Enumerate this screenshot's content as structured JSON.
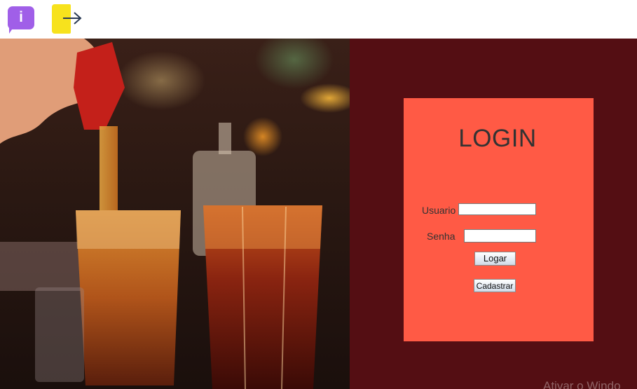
{
  "toolbar": {
    "info_icon": "info-icon",
    "info_glyph": "i",
    "exit_icon": "exit-icon",
    "info_color": "#a05fe8",
    "exit_color": "#f7e21d"
  },
  "photo": {
    "subject": "bar-drinks-photo"
  },
  "login": {
    "title": "LOGIN",
    "username_label": "Usuario",
    "username_value": "",
    "password_label": "Senha",
    "password_value": "",
    "login_button": "Logar",
    "register_button": "Cadastrar"
  },
  "colors": {
    "panel_background": "#540e13",
    "card_background": "#ff5a45",
    "title_color": "#333333"
  },
  "watermark": {
    "text": "Ativar o Windo"
  }
}
